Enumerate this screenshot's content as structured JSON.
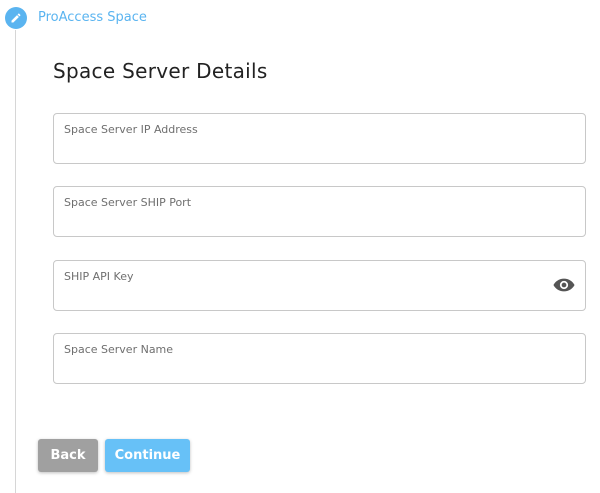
{
  "step": {
    "label": "ProAccess Space",
    "icon": "pencil-icon",
    "color": "#5ab4f0"
  },
  "section": {
    "title": "Space Server Details"
  },
  "fields": [
    {
      "label": "Space Server IP Address",
      "value": ""
    },
    {
      "label": "Space Server SHIP Port",
      "value": ""
    },
    {
      "label": "SHIP API Key",
      "value": "",
      "toggle_icon": "eye-icon"
    },
    {
      "label": "Space Server Name",
      "value": ""
    }
  ],
  "buttons": {
    "back_label": "Back",
    "continue_label": "Continue",
    "back_color": "#a0a0a0",
    "continue_color": "#67c1f7"
  }
}
